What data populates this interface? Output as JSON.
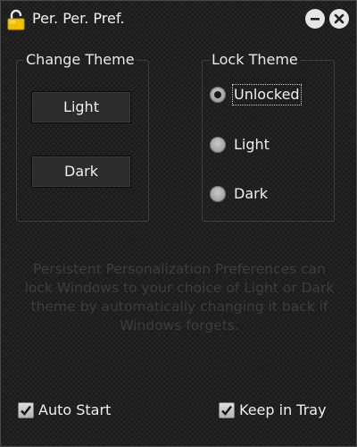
{
  "window": {
    "title": "Per. Per. Pref.",
    "icons": {
      "app": "padlock-icon",
      "minimize": "minimize-icon",
      "close": "close-icon"
    }
  },
  "change_theme": {
    "legend": "Change Theme",
    "light_label": "Light",
    "dark_label": "Dark"
  },
  "lock_theme": {
    "legend": "Lock Theme",
    "options": [
      {
        "label": "Unlocked",
        "checked": true
      },
      {
        "label": "Light",
        "checked": false
      },
      {
        "label": "Dark",
        "checked": false
      }
    ]
  },
  "description": "Persistent Personalization Preferences can lock Windows to your choice of Light or Dark theme by automatically changing it back if Windows forgets.",
  "options": {
    "auto_start": {
      "label": "Auto Start",
      "checked": true
    },
    "keep_in_tray": {
      "label": "Keep in Tray",
      "checked": true
    }
  },
  "colors": {
    "background": "#202020",
    "text": "#f0f0f0",
    "description_text": "#3c3c3c",
    "padlock": "#f0c000"
  }
}
